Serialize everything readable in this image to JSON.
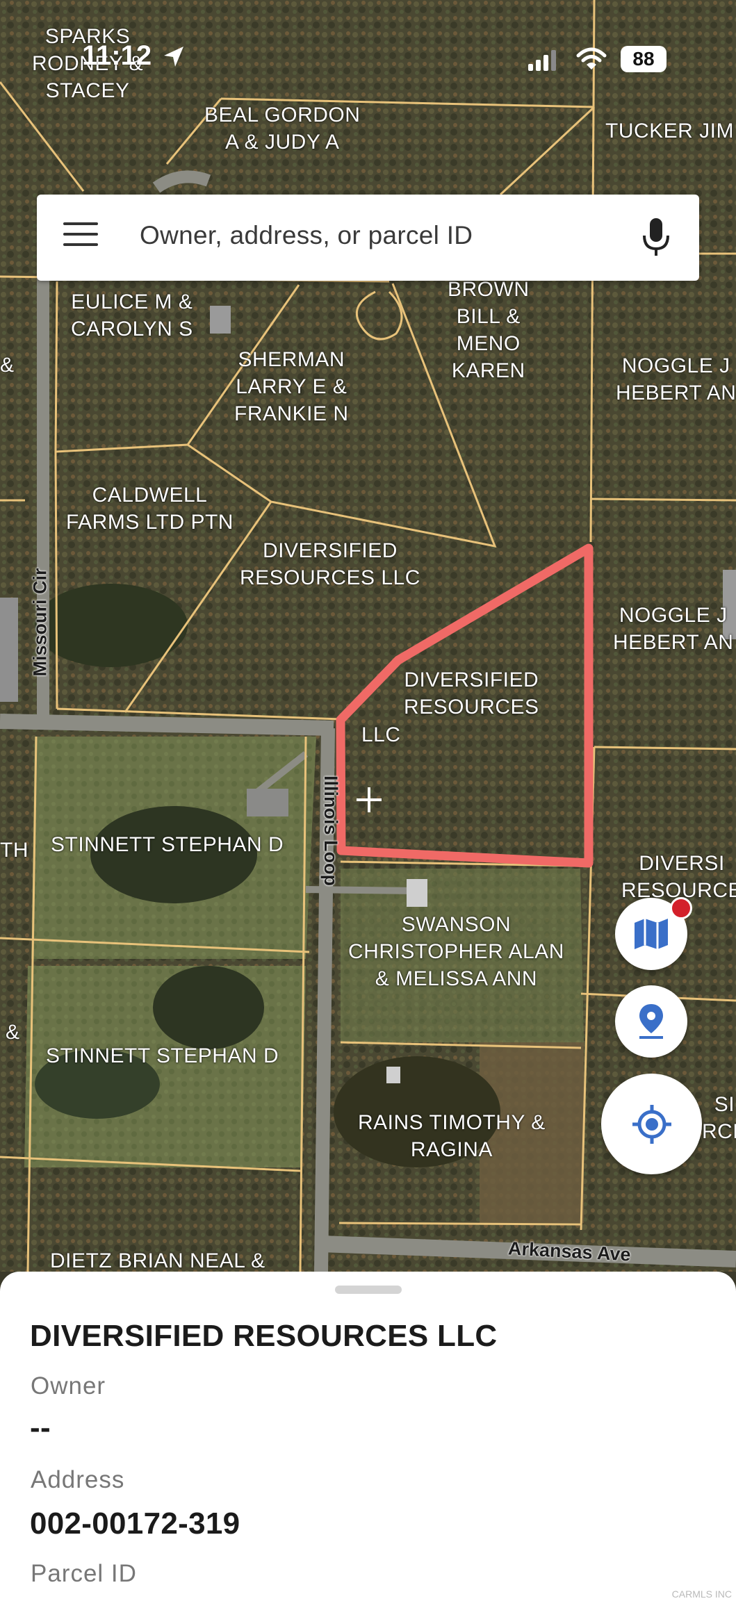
{
  "status_bar": {
    "time": "11:12",
    "battery": "88"
  },
  "search": {
    "placeholder": "Owner, address, or parcel ID"
  },
  "map": {
    "owner_labels": [
      "SPARKS\nRODNEY &\nSTACEY",
      "BEAL GORDON\nA & JUDY A",
      "TUCKER JIM",
      "EULICE M &\nCAROLYN S",
      "BROWN\nBILL &\nMENO\nKAREN",
      "SHERMAN\nLARRY E &\nFRANKIE N",
      "NOGGLE J\nHEBERT AN",
      "CALDWELL\nFARMS LTD PTN",
      "DIVERSIFIED\nRESOURCES LLC",
      "NOGGLE J\nHEBERT AN",
      "DIVERSIFIED\nRESOURCES",
      "LLC",
      "STINNETT STEPHAN D",
      "TH",
      "DIVERSI\nRESOURCE",
      "SWANSON\nCHRISTOPHER ALAN\n& MELISSA ANN",
      "&",
      "STINNETT STEPHAN D",
      "&",
      "RAINS TIMOTHY &\nRAGINA",
      "SI\nRCE",
      "DIETZ BRIAN NEAL &"
    ],
    "road_labels": [
      "Missouri Cir",
      "Illinois Loop",
      "Arkansas Ave"
    ]
  },
  "parcel": {
    "owner": "DIVERSIFIED RESOURCES LLC",
    "owner_caption": "Owner",
    "address": "--",
    "address_caption": "Address",
    "parcel_id": "002-00172-319",
    "parcel_id_caption": "Parcel ID"
  },
  "watermark": "CARMLS INC",
  "colors": {
    "selected_parcel": "#f06a66",
    "parcel_lines": "#e8c27a",
    "accent": "#3a6fc8",
    "notification_dot": "#d3202a"
  },
  "icons": [
    "location-arrow-icon",
    "signal-icon",
    "wifi-icon",
    "menu-icon",
    "mic-icon",
    "map-icon",
    "pin-icon",
    "my-location-icon",
    "crosshair-icon"
  ]
}
